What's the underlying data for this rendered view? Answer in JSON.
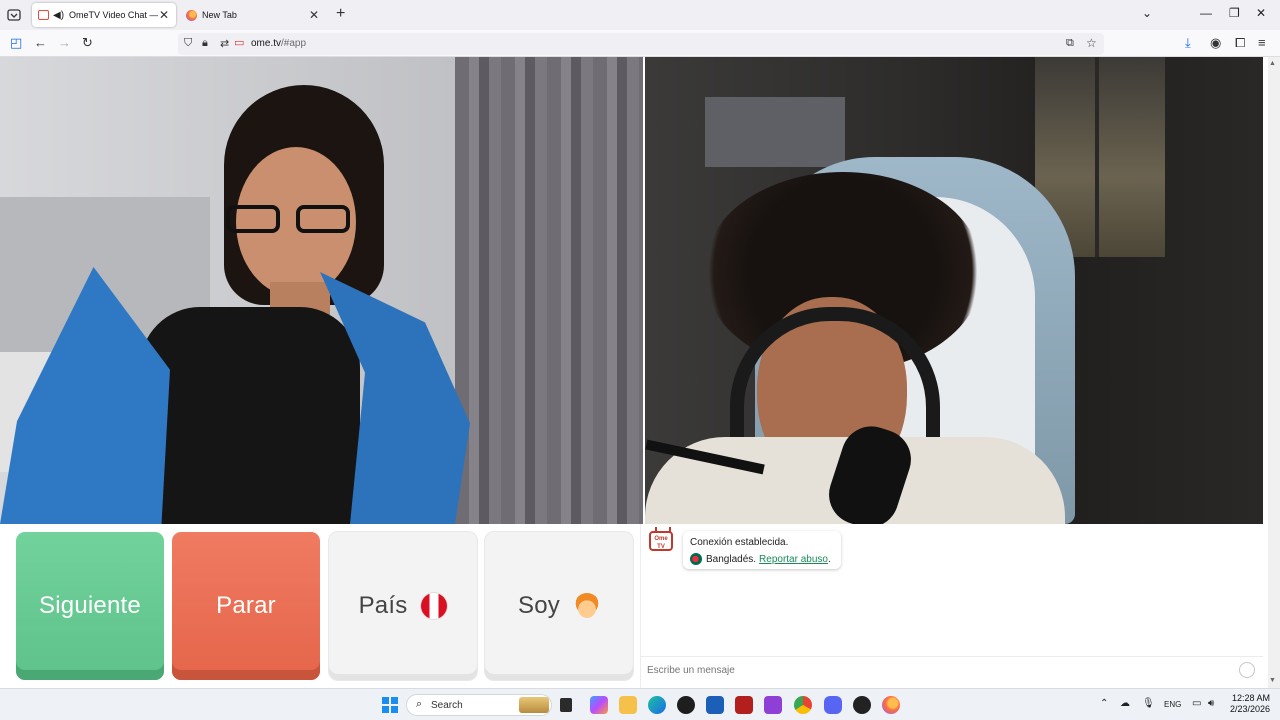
{
  "browser": {
    "tabs": [
      {
        "title": "OmeTV Video Chat — Ome",
        "active": true,
        "audio": true
      },
      {
        "title": "New Tab",
        "active": false
      }
    ],
    "url_host": "ome.tv",
    "url_path": "/#app"
  },
  "controls": {
    "next_label": "Siguiente",
    "stop_label": "Parar",
    "country_label": "País",
    "gender_label": "Soy"
  },
  "chat": {
    "logo_text": "Ome TV",
    "status": "Conexión establecida.",
    "country": "Bangladés.",
    "report_label": "Reportar abuso",
    "report_suffix": ".",
    "input_placeholder": "Escribe un mensaje"
  },
  "taskbar": {
    "search_label": "Search",
    "lang": "ENG",
    "time": "12:28 AM",
    "date": "2/23/2026"
  },
  "colors": {
    "next": "#5ec28a",
    "stop": "#e5654a",
    "link": "#1a8a5a",
    "tab_bar": "#f0f0f4"
  }
}
